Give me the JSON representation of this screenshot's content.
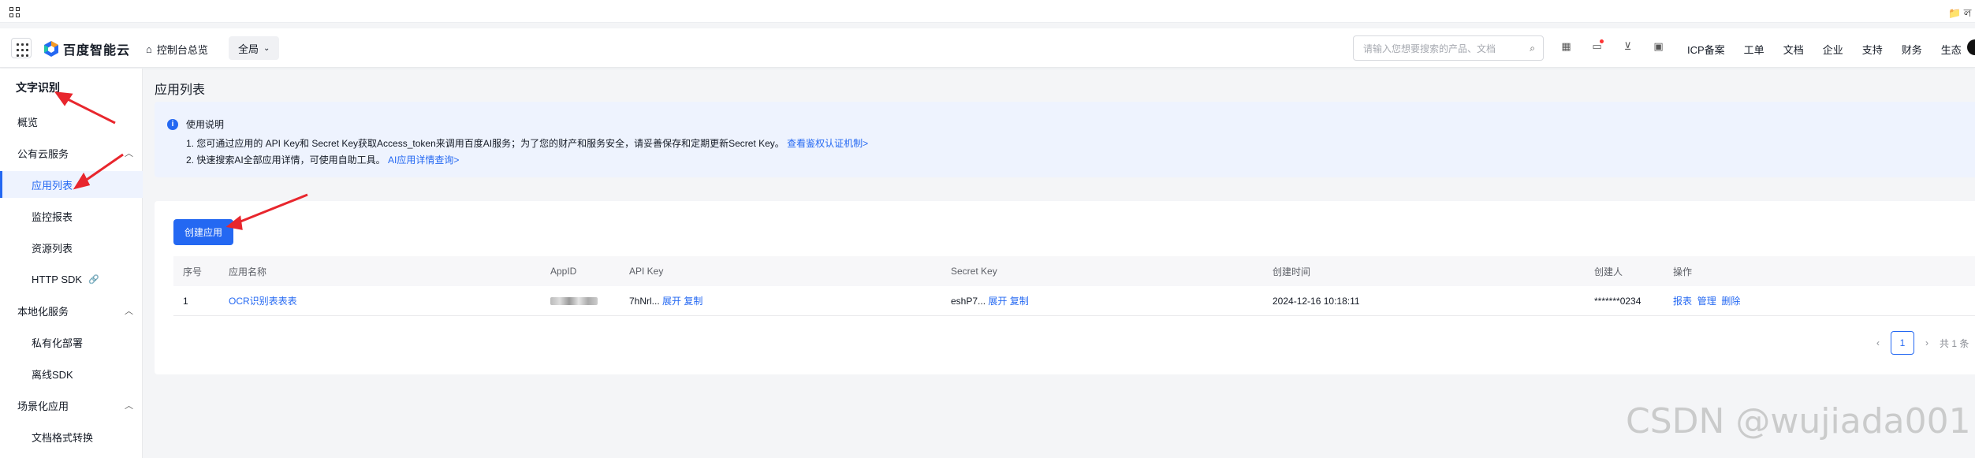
{
  "topbar": {
    "folder_label": "📁 ল"
  },
  "header": {
    "logo_text": "百度智能云",
    "home_label": "控制台总览",
    "region": "全局",
    "search_placeholder": "请输入您想要搜索的产品、文档",
    "nav": [
      "ICP备案",
      "工单",
      "文档",
      "企业",
      "支持",
      "财务",
      "生态"
    ]
  },
  "sidebar": {
    "title": "文字识别",
    "overview": "概览",
    "groups": [
      {
        "label": "公有云服务",
        "items": [
          "应用列表",
          "监控报表",
          "资源列表",
          "HTTP SDK"
        ]
      },
      {
        "label": "本地化服务",
        "items": [
          "私有化部署",
          "离线SDK"
        ]
      },
      {
        "label": "场景化应用",
        "items": [
          "文档格式转换"
        ]
      }
    ]
  },
  "main": {
    "title": "应用列表",
    "notice": {
      "title": "使用说明",
      "line1_text": "1. 您可通过应用的 API Key和 Secret Key获取Access_token来调用百度AI服务；为了您的财产和服务安全，请妥善保存和定期更新Secret Key。",
      "line1_link": "查看鉴权认证机制>",
      "line2_text": "2. 快速搜索AI全部应用详情，可使用自助工具。",
      "line2_link": "AI应用详情查询>"
    },
    "create_button": "创建应用",
    "table": {
      "headers": [
        "序号",
        "应用名称",
        "AppID",
        "API Key",
        "Secret Key",
        "创建时间",
        "创建人",
        "操作"
      ],
      "row": {
        "index": "1",
        "name": "OCR识别表表表",
        "api_key": "7hNrl...",
        "api_expand": "展开",
        "api_copy": "复制",
        "secret_key": "eshP7...",
        "secret_expand": "展开",
        "secret_copy": "复制",
        "created_at": "2024-12-16 10:18:11",
        "creator": "*******0234",
        "actions": [
          "报表",
          "管理",
          "删除"
        ]
      }
    },
    "pager": {
      "current": "1",
      "total_label": "共 1 条"
    }
  },
  "watermark": "CSDN @wujiada001",
  "colors": {
    "accent": "#2468f2",
    "arrow": "#e8262d"
  }
}
